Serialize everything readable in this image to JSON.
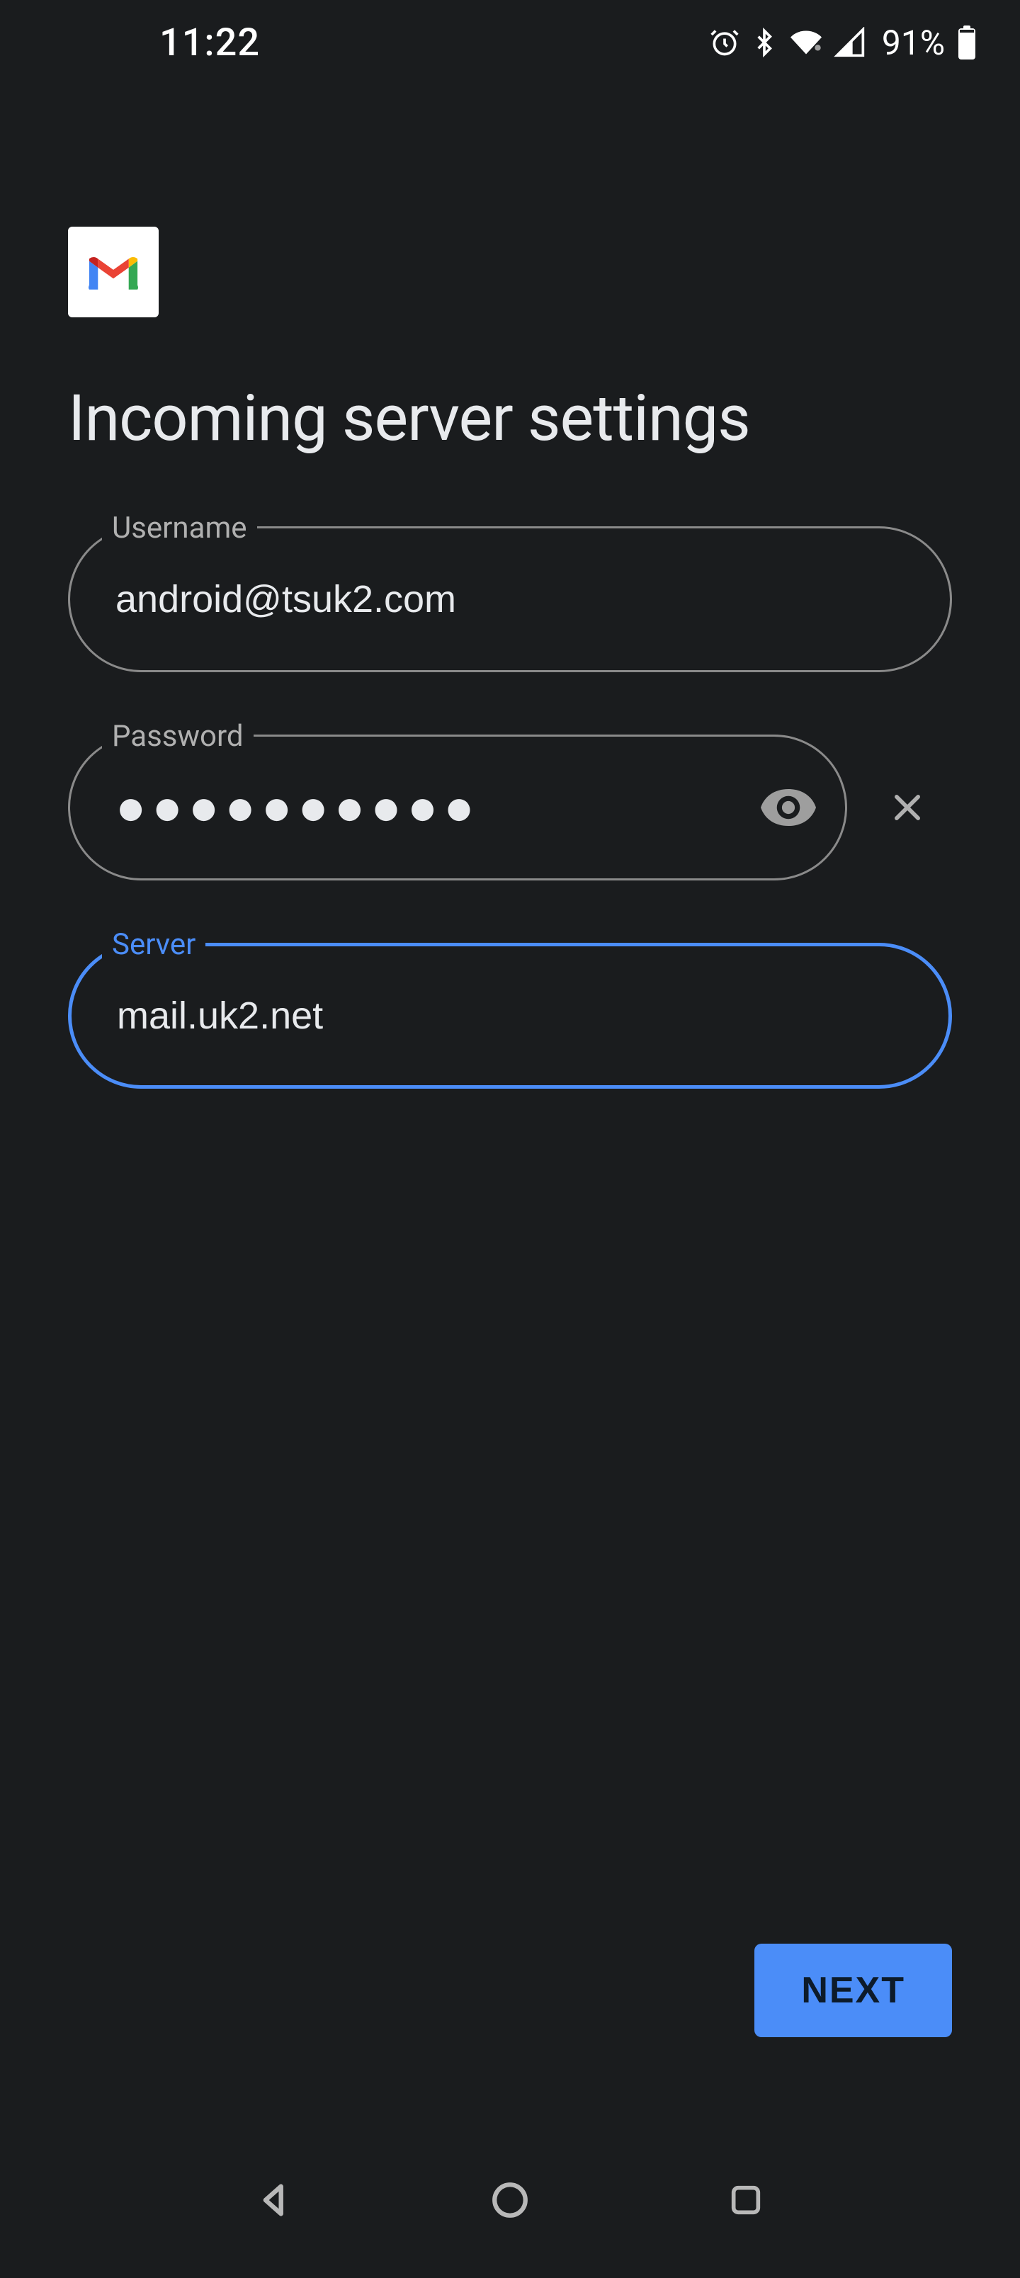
{
  "status": {
    "time": "11:22",
    "battery_pct": "91%"
  },
  "page": {
    "title": "Incoming server settings"
  },
  "fields": {
    "username": {
      "label": "Username",
      "value": "android@tsuk2.com"
    },
    "password": {
      "label": "Password",
      "value": "●●●●●●●●●●"
    },
    "server": {
      "label": "Server",
      "value": "mail.uk2.net"
    }
  },
  "actions": {
    "next": "NEXT"
  }
}
